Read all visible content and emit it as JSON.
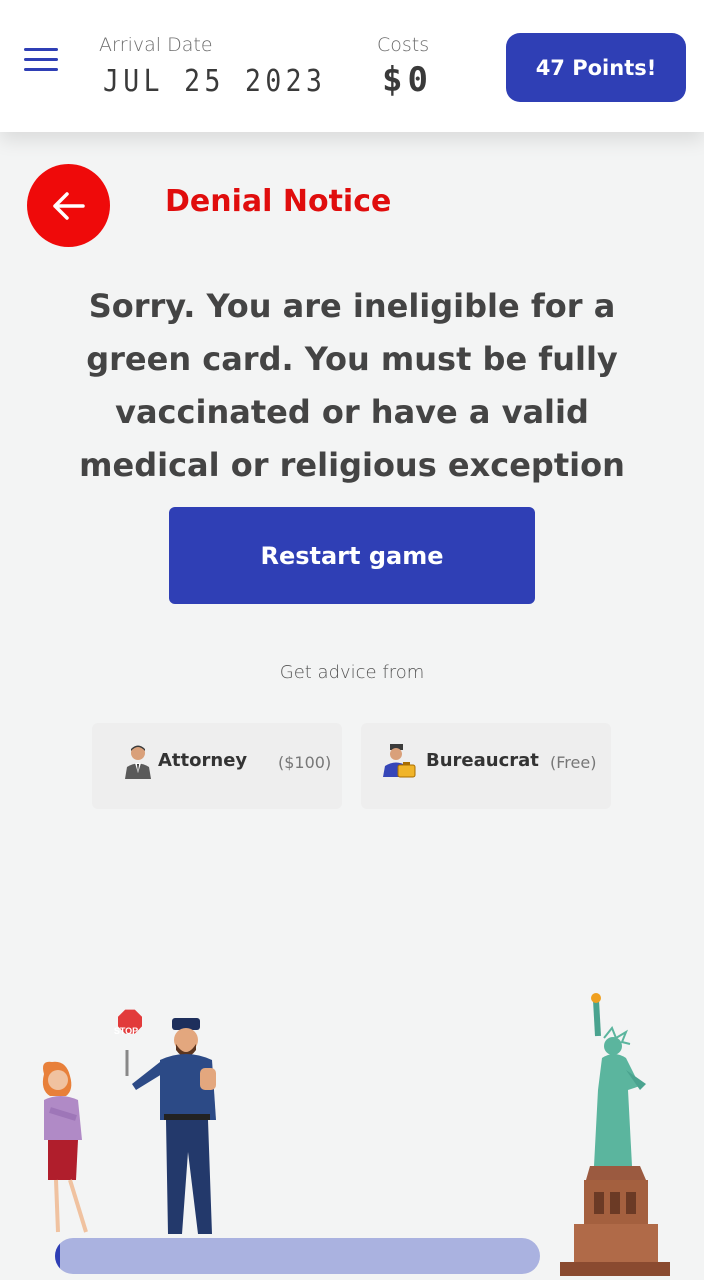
{
  "header": {
    "arrival_label": "Arrival Date",
    "arrival_value": "JUL 25 2023",
    "costs_label": "Costs",
    "costs_value": "$0",
    "points_label": "47 Points!"
  },
  "notice": {
    "title": "Denial Notice",
    "message": "Sorry. You are ineligible for a green card. You must be fully vaccinated or have a valid medical or religious exception",
    "restart_label": "Restart game"
  },
  "advice": {
    "label": "Get advice from",
    "advisors": [
      {
        "name": "Attorney",
        "price": "($100)",
        "icon": "attorney-icon"
      },
      {
        "name": "Bureaucrat",
        "price": "(Free)",
        "icon": "bureaucrat-icon"
      }
    ]
  },
  "progress": {
    "fraction": 0.01
  },
  "colors": {
    "accent": "#2f3fb5",
    "danger": "#ef0a0a",
    "background": "#f3f4f4"
  }
}
